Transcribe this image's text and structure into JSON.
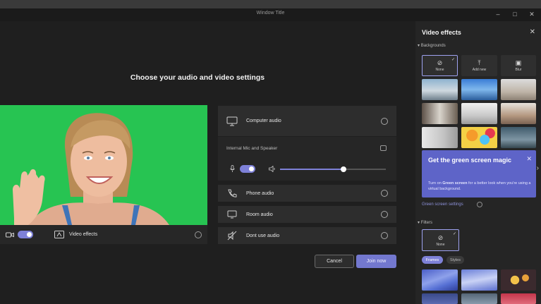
{
  "window": {
    "title": "Window Title",
    "controls": [
      "–",
      "□",
      "✕"
    ]
  },
  "main": {
    "heading": "Choose your audio and video settings"
  },
  "video_bar": {
    "effects_label": "Video effects"
  },
  "audio": {
    "computer_audio": "Computer audio",
    "device_label": "Internal Mic and Speaker",
    "volume_level": 0.6,
    "phone_audio": "Phone audio",
    "room_audio": "Room audio",
    "dont_use_audio": "Dont use audio"
  },
  "actions": {
    "cancel": "Cancel",
    "join": "Join now"
  },
  "panel": {
    "title": "Video effects",
    "backgrounds_label": "Backgrounds",
    "bg_options": [
      {
        "label": "None"
      },
      {
        "label": "Add new"
      },
      {
        "label": "Blur"
      }
    ],
    "greenscreen": {
      "title": "Get the green screen magic",
      "text_before": "Turn on ",
      "text_bold": "Green screen",
      "text_after": " for a better look when you're using a virtual background.",
      "link": "Green screen settings"
    },
    "filters_label": "Filters",
    "filter_none": "None",
    "filter_tabs": [
      "Frames",
      "Styles"
    ]
  },
  "colors": {
    "accent": "#7e81d8",
    "green_screen": "#27c452",
    "card": "#5e64c8"
  }
}
